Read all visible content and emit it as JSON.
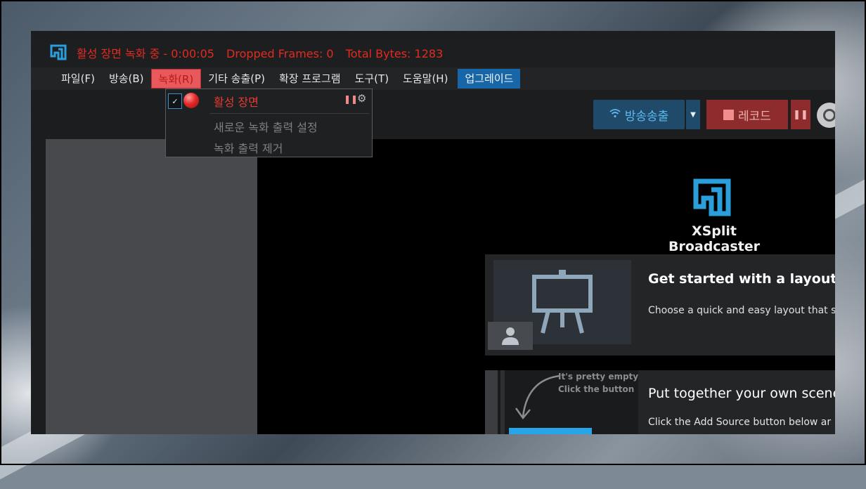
{
  "window": {
    "title_status": "활성 장면 녹화 중 - 0:00:05",
    "dropped_frames": "Dropped Frames: 0",
    "total_bytes": "Total Bytes: 1283"
  },
  "menu": {
    "items": [
      {
        "label": "파일(F)"
      },
      {
        "label": "방송(B)"
      },
      {
        "label": "녹화(R)",
        "active": true
      },
      {
        "label": "기타 송출(P)"
      },
      {
        "label": "확장 프로그램"
      },
      {
        "label": "도구(T)"
      },
      {
        "label": "도움말(H)"
      },
      {
        "label": "업그레이드"
      }
    ]
  },
  "record_menu": {
    "active_scene": "활성 장면",
    "new_output": "새로운 녹화 출력 설정",
    "remove_output": "녹화 출력 제거"
  },
  "toolbar": {
    "stream_label": "방송송출",
    "record_label": "레코드"
  },
  "main": {
    "brand": "XSplit Broadcaster",
    "layout_card": {
      "title": "Get started with a layout",
      "subtitle": "Choose a quick and easy layout that s"
    },
    "scene_card": {
      "hint_line1": "It's pretty empty",
      "hint_line2": "Click the button",
      "title": "Put together your own scene",
      "subtitle": "Click the Add Source button below ar"
    }
  },
  "colors": {
    "title_red": "#e42a1f",
    "menu_active_bg": "#e9585a",
    "upgrade_blue": "#1766a8",
    "stream_bg": "#1f4a69",
    "record_bg": "#8e2b2c",
    "brand_blue": "#2a9fdc"
  }
}
